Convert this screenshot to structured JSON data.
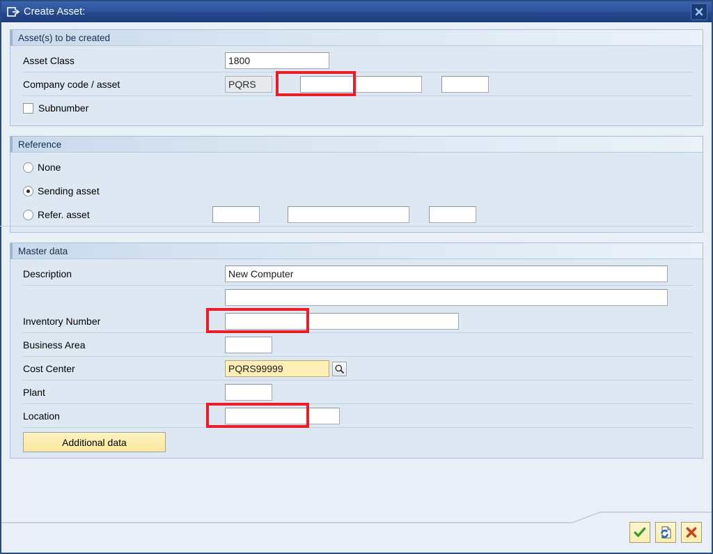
{
  "window": {
    "title": "Create Asset:",
    "title_icon": "window-export-icon",
    "close_icon": "close-icon"
  },
  "groups": {
    "assets_to_create": {
      "header": "Asset(s) to be created",
      "asset_class": {
        "label": "Asset Class",
        "value": "1800",
        "highlighted": true
      },
      "company_code_asset": {
        "label": "Company code / asset",
        "company_code": "PQRS",
        "asset_number": "",
        "asset_suffix": ""
      },
      "subnumber": {
        "label": "Subnumber",
        "checked": false
      }
    },
    "reference": {
      "header": "Reference",
      "options": [
        {
          "label": "None",
          "selected": false
        },
        {
          "label": "Sending asset",
          "selected": true
        },
        {
          "label": "Refer. asset",
          "selected": false
        }
      ],
      "refer_asset_fields": {
        "company_code": "",
        "asset_number": "",
        "asset_suffix": ""
      }
    },
    "master_data": {
      "header": "Master data",
      "description": {
        "label": "Description",
        "value": "New Computer",
        "highlighted": true
      },
      "description_line2": {
        "value": ""
      },
      "inventory_number": {
        "label": "Inventory Number",
        "value": ""
      },
      "business_area": {
        "label": "Business Area",
        "value": ""
      },
      "cost_center": {
        "label": "Cost Center",
        "value": "PQRS99999",
        "highlighted": true,
        "search_help_icon": "magnifier-icon"
      },
      "plant": {
        "label": "Plant",
        "value": ""
      },
      "location": {
        "label": "Location",
        "value": ""
      },
      "additional_data_button": "Additional data"
    }
  },
  "footer": {
    "buttons": [
      {
        "name": "continue-button",
        "icon": "green-check-icon"
      },
      {
        "name": "restore-button",
        "icon": "document-refresh-icon"
      },
      {
        "name": "cancel-button",
        "icon": "red-x-icon"
      }
    ]
  },
  "colors": {
    "titlebar": "#2d549c",
    "annotation": "#ee1c25",
    "group_background": "#dde8f3",
    "window_background": "#e9eff7",
    "highlight_field": "#fdefb5"
  }
}
